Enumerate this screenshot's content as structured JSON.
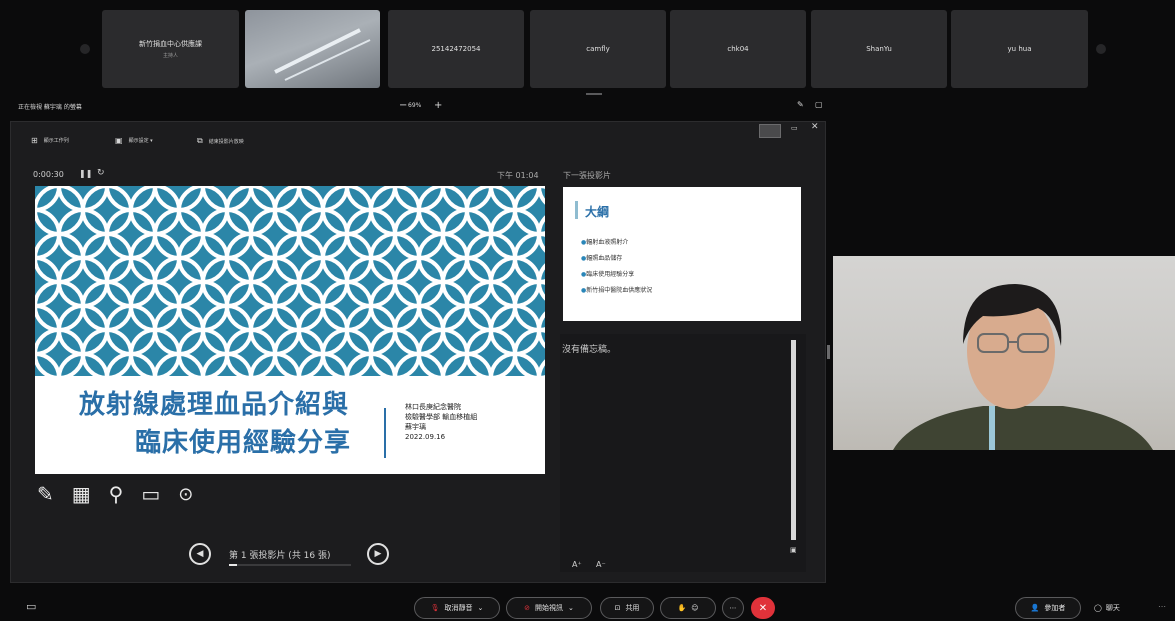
{
  "participants": [
    {
      "name": "新竹捐血中心供應課",
      "sub": "主持人"
    },
    {
      "name": "",
      "sub": ""
    },
    {
      "name": "25142472054",
      "sub": ""
    },
    {
      "name": "camfly",
      "sub": ""
    },
    {
      "name": "chk04",
      "sub": ""
    },
    {
      "name": "ShanYu",
      "sub": ""
    },
    {
      "name": "yu hua",
      "sub": ""
    }
  ],
  "viewbar": {
    "label": "正在檢視 蘇宇璃 的螢幕",
    "zoom_minus": "−",
    "zoom": "69%",
    "zoom_plus": "+"
  },
  "presenter": {
    "toolbar": [
      "顯示工作列",
      "顯示設定 ▾",
      "結束投影片放映"
    ],
    "timer": "0:00:30",
    "clock": "下午 01:04",
    "next_slide_label": "下一張投影片",
    "slide": {
      "title_line1": "放射線處理血品介紹與",
      "title_line2": "臨床使用經驗分享",
      "info": [
        "林口長庚紀念醫院",
        "檢驗醫學部 輸血移植組",
        "蘇宇璃",
        "2022.09.16"
      ]
    },
    "next_slide": {
      "title": "大綱",
      "bullets": [
        "輻射血液照射介",
        "輻照血品儲存",
        "臨床使用經驗分享",
        "新竹捐中醫院血供應狀況"
      ]
    },
    "notes_text": "沒有備忘稿。",
    "counter": "第 1 張投影片 (共 16 張)",
    "progress": 0.0625
  },
  "bottom": {
    "unmute": "取消靜音",
    "video": "開始視訊",
    "share": "共用",
    "participants": "參加者",
    "chat": "聊天"
  },
  "colors": {
    "accent_red": "#e0323a",
    "slide_teal": "#2b86a8"
  }
}
